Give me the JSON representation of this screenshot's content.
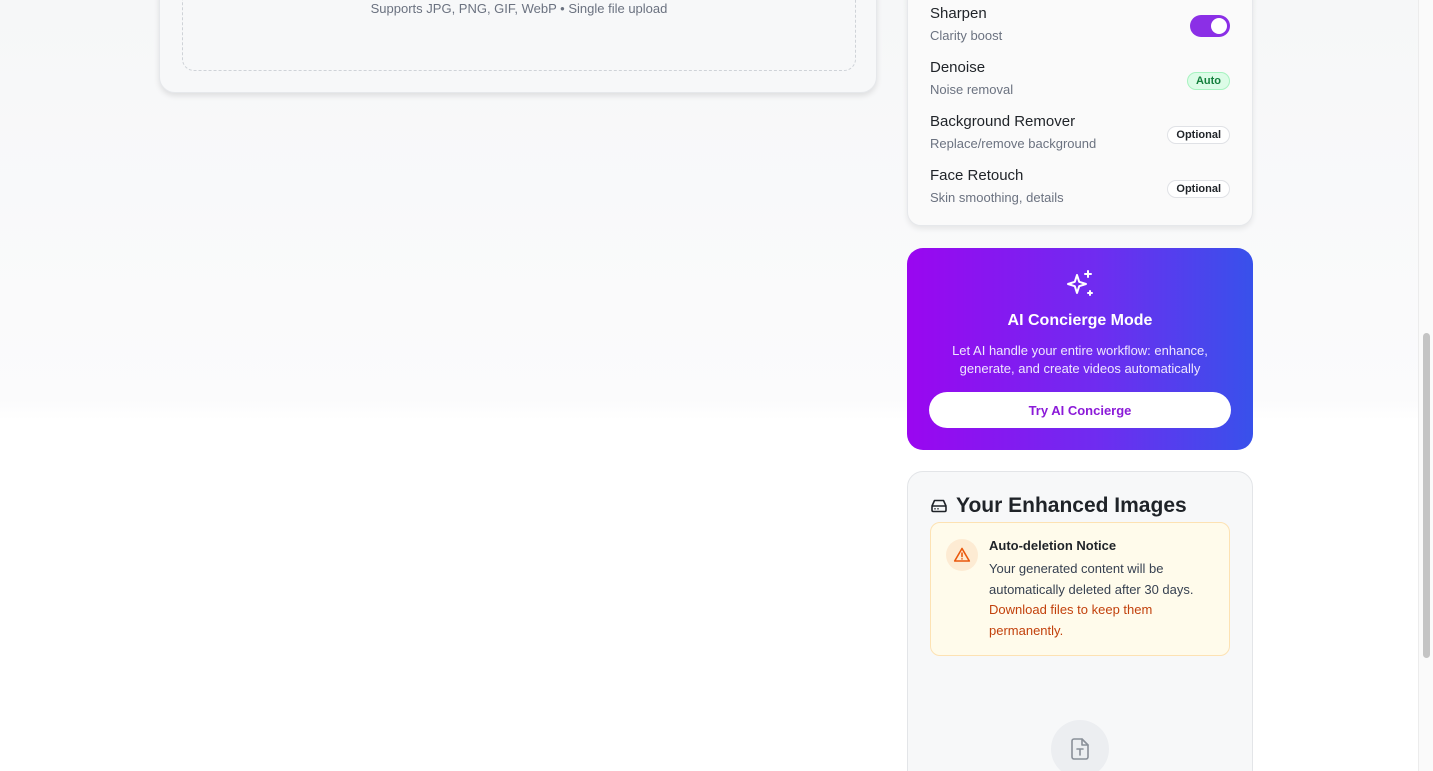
{
  "upload": {
    "hint": "Supports JPG, PNG, GIF, WebP • Single file upload"
  },
  "tools": [
    {
      "name": "Sharpen",
      "desc": "Clarity boost",
      "control": "toggle",
      "enabled": true
    },
    {
      "name": "Denoise",
      "desc": "Noise removal",
      "control": "badge",
      "badge": "Auto"
    },
    {
      "name": "Background Remover",
      "desc": "Replace/remove background",
      "control": "badge",
      "badge": "Optional"
    },
    {
      "name": "Face Retouch",
      "desc": "Skin smoothing, details",
      "control": "badge",
      "badge": "Optional"
    }
  ],
  "concierge": {
    "icon": "sparkles-icon",
    "title": "AI Concierge Mode",
    "description": "Let AI handle your entire workflow: enhance, generate, and create videos automatically",
    "button": "Try AI Concierge"
  },
  "gallery": {
    "icon": "hard-drive-icon",
    "title": "Your Enhanced Images",
    "notice": {
      "icon": "warning-triangle-icon",
      "title": "Auto-deletion Notice",
      "body": "Your generated content will be automatically deleted after 30 days.",
      "link": "Download files to keep them permanently."
    },
    "empty_icon": "file-text-icon"
  },
  "colors": {
    "accent_purple": "#8b2fe6",
    "concierge_gradient_start": "#9a06f0",
    "concierge_gradient_end": "#3851eb",
    "notice_link": "#c2410c",
    "badge_auto": "#15803d"
  }
}
